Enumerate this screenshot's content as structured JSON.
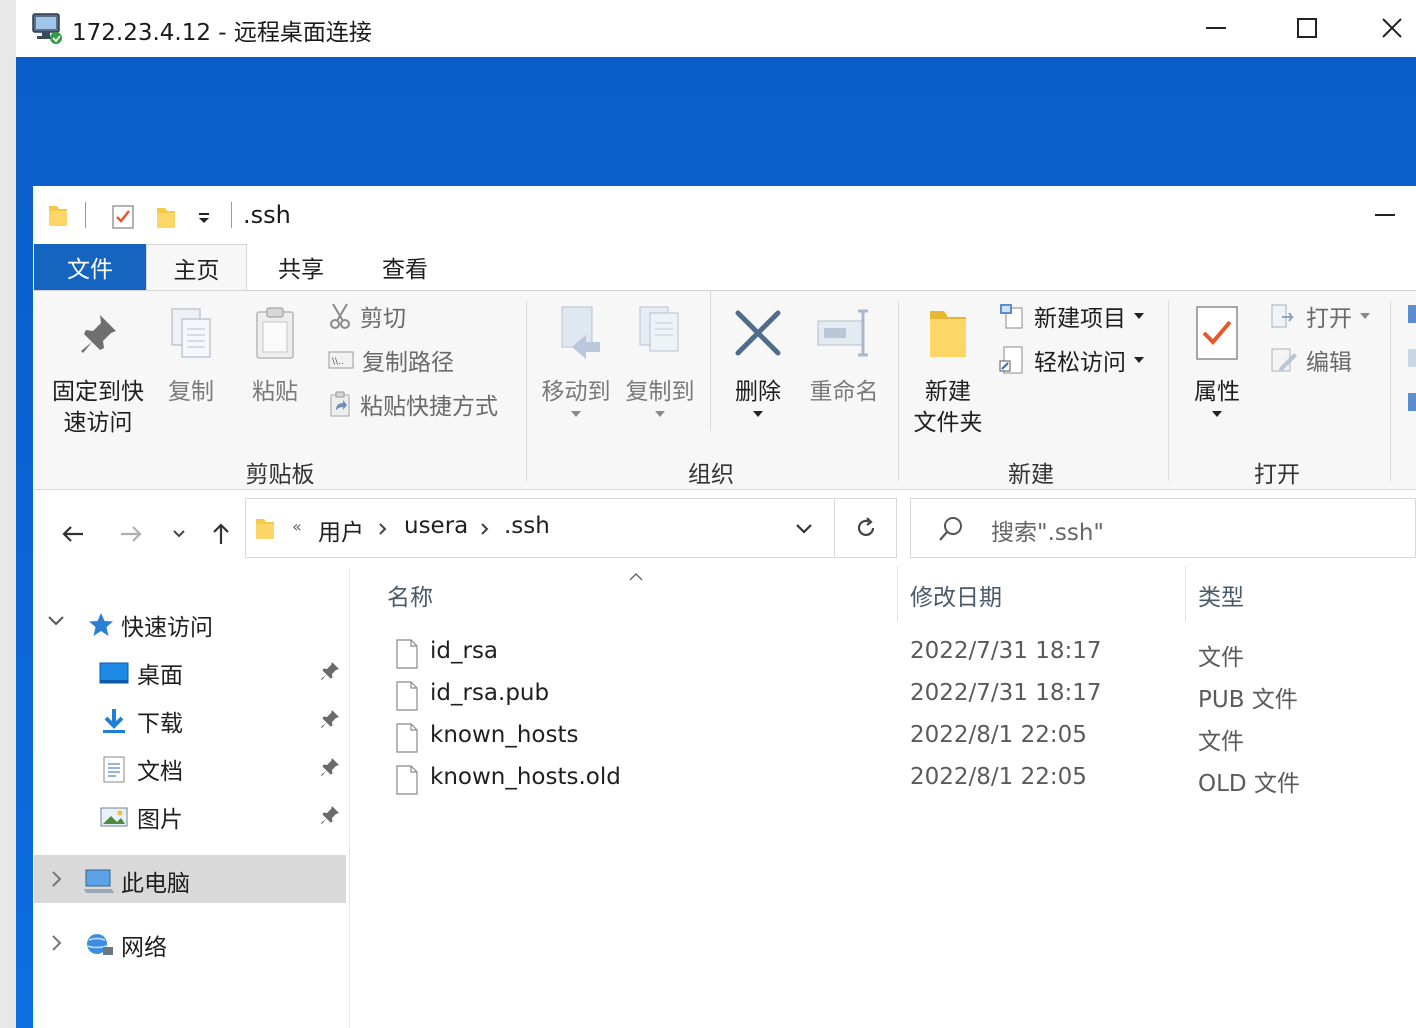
{
  "rdp": {
    "title": "172.23.4.12 - 远程桌面连接",
    "minimize_icon": "minimize-icon",
    "maximize_icon": "maximize-icon",
    "close_icon": "close-icon"
  },
  "explorer": {
    "title": ".ssh",
    "tabs": [
      "文件",
      "主页",
      "共享",
      "查看"
    ],
    "ribbon": {
      "clipboard": {
        "pin_label_line1": "固定到快",
        "pin_label_line2": "速访问",
        "copy_label": "复制",
        "paste_label": "粘贴",
        "cut_label": "剪切",
        "copy_path_label": "复制路径",
        "paste_shortcut_label": "粘贴快捷方式",
        "group_label": "剪贴板"
      },
      "organize": {
        "move_to_label": "移动到",
        "copy_to_label": "复制到",
        "delete_label": "删除",
        "rename_label": "重命名",
        "group_label": "组织"
      },
      "new": {
        "new_folder_line1": "新建",
        "new_folder_line2": "文件夹",
        "new_item_label": "新建项目",
        "easy_access_label": "轻松访问",
        "group_label": "新建"
      },
      "open": {
        "properties_label": "属性",
        "open_label": "打开",
        "edit_label": "编辑",
        "group_label": "打开"
      }
    },
    "address": {
      "overflow": "«",
      "crumbs": [
        "用户",
        "usera",
        ".ssh"
      ],
      "search_placeholder": "搜索\".ssh\""
    },
    "nav": {
      "quick_access": "快速访问",
      "pinned": [
        {
          "label": "桌面",
          "icon": "desktop-icon"
        },
        {
          "label": "下载",
          "icon": "download-icon"
        },
        {
          "label": "文档",
          "icon": "documents-icon"
        },
        {
          "label": "图片",
          "icon": "pictures-icon"
        }
      ],
      "this_pc": "此电脑",
      "network": "网络"
    },
    "columns": {
      "name": "名称",
      "modified": "修改日期",
      "type": "类型"
    },
    "files": [
      {
        "name": "id_rsa",
        "modified": "2022/7/31 18:17",
        "type": "文件"
      },
      {
        "name": "id_rsa.pub",
        "modified": "2022/7/31 18:17",
        "type": "PUB 文件"
      },
      {
        "name": "known_hosts",
        "modified": "2022/8/1 22:05",
        "type": "文件"
      },
      {
        "name": "known_hosts.old",
        "modified": "2022/8/1 22:05",
        "type": "OLD 文件"
      }
    ]
  },
  "colors": {
    "desktop_blue": "#0a63d2",
    "file_tab_blue": "#1565c0",
    "folder_yellow": "#f6c94a",
    "selected_nav": "#d9d9d9"
  }
}
